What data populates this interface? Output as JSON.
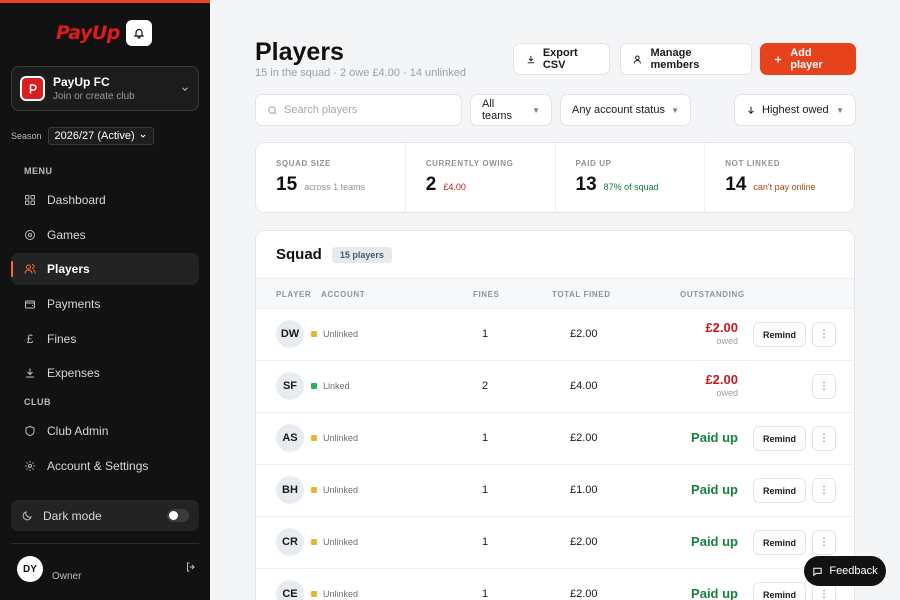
{
  "sidebar": {
    "logo": "PayUp",
    "club": {
      "name": "PayUp FC",
      "subtitle": "Join or create club"
    },
    "season": {
      "label": "Season",
      "value": "2026/27 (Active)"
    },
    "menu_label": "MENU",
    "menu": [
      {
        "label": "Dashboard",
        "icon": "grid-icon"
      },
      {
        "label": "Games",
        "icon": "target-icon"
      },
      {
        "label": "Players",
        "icon": "users-icon",
        "active": true
      },
      {
        "label": "Payments",
        "icon": "wallet-icon"
      },
      {
        "label": "Fines",
        "icon": "pound-icon"
      },
      {
        "label": "Expenses",
        "icon": "download-icon"
      }
    ],
    "club_label": "CLUB",
    "club_menu": [
      {
        "label": "Club Admin",
        "icon": "shield-icon"
      },
      {
        "label": "Account & Settings",
        "icon": "gear-icon"
      }
    ],
    "dark_mode": {
      "label": "Dark mode",
      "on": false
    },
    "user": {
      "initials": "DY",
      "role": "Owner"
    }
  },
  "header": {
    "title": "Players",
    "subtitle": "15 in the squad · 2 owe £4.00 · 14 unlinked",
    "export_label": "Export CSV",
    "manage_label": "Manage members",
    "add_label": "Add player"
  },
  "filters": {
    "search_placeholder": "Search players",
    "teams": "All teams",
    "status": "Any account status",
    "sort": "Highest owed"
  },
  "stats": [
    {
      "label": "SQUAD SIZE",
      "value": "15",
      "note": "across 1 teams"
    },
    {
      "label": "CURRENTLY OWING",
      "value": "2",
      "note": "£4.00"
    },
    {
      "label": "PAID UP",
      "value": "13",
      "note": "87% of squad"
    },
    {
      "label": "NOT LINKED",
      "value": "14",
      "note": "can't pay online"
    }
  ],
  "squad": {
    "title": "Squad",
    "badge": "15 players",
    "columns": {
      "player": "PLAYER",
      "account": "ACCOUNT",
      "fines": "FINES",
      "total": "TOTAL FINED",
      "outstanding": "OUTSTANDING"
    },
    "rows": [
      {
        "initials": "DW",
        "account": "Unlinked",
        "fines": "1",
        "total": "£2.00",
        "outstanding": "£2.00",
        "owed_label": "owed",
        "paid_label": "",
        "remind": "Remind"
      },
      {
        "initials": "SF",
        "account": "Linked",
        "fines": "2",
        "total": "£4.00",
        "outstanding": "£2.00",
        "owed_label": "owed",
        "paid_label": "",
        "remind": ""
      },
      {
        "initials": "AS",
        "account": "Unlinked",
        "fines": "1",
        "total": "£2.00",
        "outstanding": "",
        "owed_label": "",
        "paid_label": "Paid up",
        "remind": "Remind"
      },
      {
        "initials": "BH",
        "account": "Unlinked",
        "fines": "1",
        "total": "£1.00",
        "outstanding": "",
        "owed_label": "",
        "paid_label": "Paid up",
        "remind": "Remind"
      },
      {
        "initials": "CR",
        "account": "Unlinked",
        "fines": "1",
        "total": "£2.00",
        "outstanding": "",
        "owed_label": "",
        "paid_label": "Paid up",
        "remind": "Remind"
      },
      {
        "initials": "CE",
        "account": "Unlinked",
        "fines": "1",
        "total": "£2.00",
        "outstanding": "",
        "owed_label": "",
        "paid_label": "Paid up",
        "remind": "Remind"
      }
    ]
  },
  "feedback_label": "Feedback",
  "colors": {
    "accent": "#e6431c",
    "sidebar_bg": "#121212",
    "owed": "#c41c1c",
    "paid": "#17803d",
    "unlinked_dot": "#e8b339",
    "linked_dot": "#2fae5b"
  }
}
